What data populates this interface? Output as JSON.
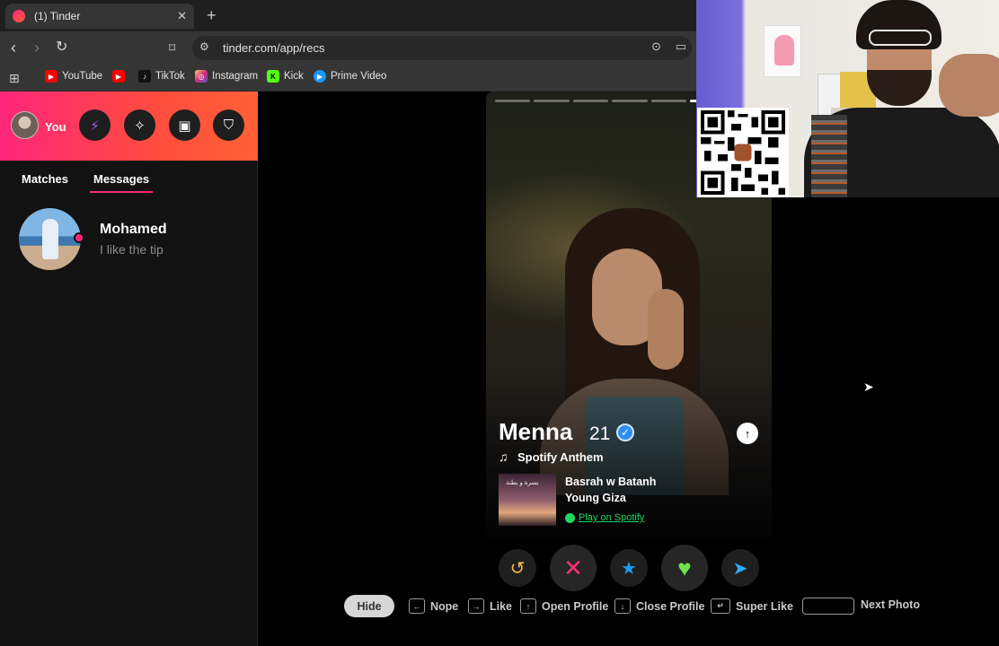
{
  "browser": {
    "tab_title": "(1) Tinder",
    "url": "tinder.com/app/recs",
    "bookmarks": [
      {
        "label": "YouTube",
        "color": "#ff0000"
      },
      {
        "label": "",
        "color": "#ff0000"
      },
      {
        "label": "TikTok",
        "color": "#111111"
      },
      {
        "label": "Instagram",
        "color": "#d62976"
      },
      {
        "label": "Kick",
        "color": "#53fc18"
      },
      {
        "label": "Prime Video",
        "color": "#1a98ff"
      }
    ]
  },
  "sidebar": {
    "me_label": "You",
    "tabs": [
      "Matches",
      "Messages"
    ],
    "active_tab": "Messages",
    "conversation": {
      "name": "Mohamed",
      "preview": "I like the tip"
    }
  },
  "card": {
    "name": "Menna",
    "age": "21",
    "verified": true,
    "photo_index": 6,
    "photo_count": 7,
    "spotify_heading": "Spotify Anthem",
    "album_text": "بسرة و بطنة",
    "song": "Basrah w Batanh",
    "artist": "Young Giza",
    "play_label": "Play on Spotify"
  },
  "actions": [
    {
      "name": "rewind",
      "icon": "rewind-icon",
      "color": "#f5b748"
    },
    {
      "name": "nope",
      "icon": "x-icon",
      "color": "#fd2f79"
    },
    {
      "name": "super-like",
      "icon": "star-icon",
      "color": "#1d9bf0"
    },
    {
      "name": "like",
      "icon": "heart-icon",
      "color": "#6ee44c"
    },
    {
      "name": "boost",
      "icon": "send-icon",
      "color": "#33a9ff"
    }
  ],
  "hints": {
    "hide": "Hide",
    "nope": "Nope",
    "like": "Like",
    "open_profile": "Open Profile",
    "close_profile": "Close Profile",
    "super_like": "Super Like",
    "next_photo": "Next Photo"
  },
  "colors": {
    "brand_start": "#fd267a",
    "brand_end": "#ff6036",
    "spotify_green": "#1ed760"
  }
}
